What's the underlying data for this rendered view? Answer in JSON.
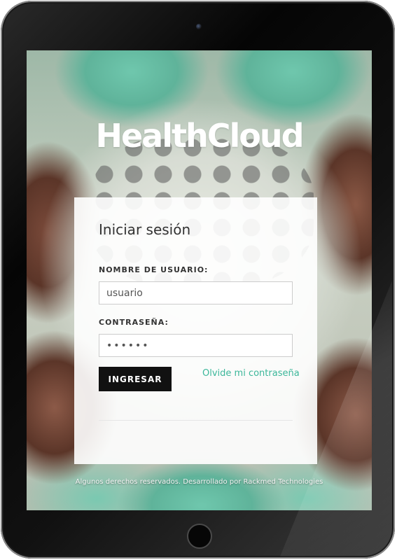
{
  "app": {
    "logo_text": "HealthCloud"
  },
  "login": {
    "title": "Iniciar sesión",
    "username_label": "NOMBRE DE USUARIO:",
    "username_value": "usuario",
    "password_label": "CONTRASEÑA:",
    "password_value": "••••••",
    "submit_label": "INGRESAR",
    "forgot_label": "Olvide mi contraseña"
  },
  "footer": {
    "text": "Algunos derechos reservados. Desarrollado por Rackmed Technologies"
  },
  "colors": {
    "accent": "#3cb79a",
    "button_bg": "#111111",
    "card_bg": "#ffffff"
  },
  "icons": {
    "camera": "camera-icon",
    "home": "home-button-icon"
  }
}
